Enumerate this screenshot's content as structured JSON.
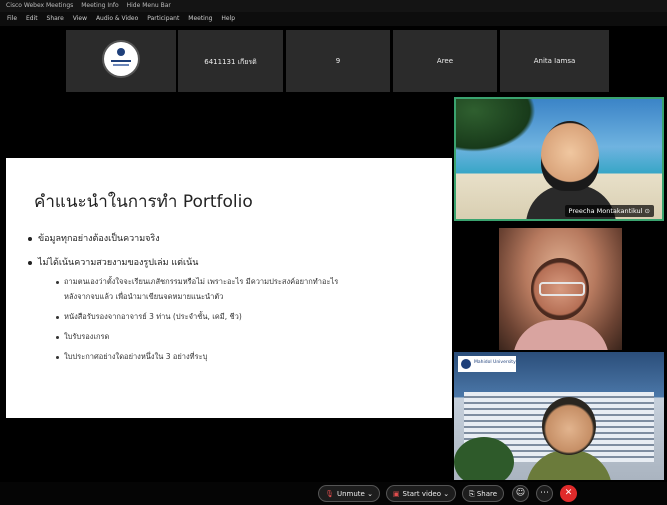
{
  "window": {
    "app_title": "Cisco Webex Meetings",
    "meeting_info": "Meeting Info",
    "hide_menu": "Hide Menu Bar"
  },
  "menu": [
    "File",
    "Edit",
    "Share",
    "View",
    "Audio & Video",
    "Participant",
    "Meeting",
    "Help"
  ],
  "participants_strip": [
    {
      "name": ""
    },
    {
      "name": "6411131 เกียรติ"
    },
    {
      "name": "9"
    },
    {
      "name": "Aree"
    },
    {
      "name": "Anita Iamsa"
    }
  ],
  "slide": {
    "title": "คำแนะนำในการทำ Portfolio",
    "bullets": [
      {
        "text": "ข้อมูลทุกอย่างต้องเป็นความจริง",
        "sub": []
      },
      {
        "text": "ไม่ได้เน้นความสวยงามของรูปเล่ม แต่เน้น",
        "sub": [
          "ถามตนเองว่าตั้งใจจะเรียนเภสัชกรรมหรือไม่ เพราะอะไร มีความประสงค์อยากทำอะไร",
          "หลังจากจบแล้ว เพื่อนำมาเขียนจดหมายแนะนำตัว",
          "หนังสือรับรองจากอาจารย์ 3 ท่าน (ประจำชั้น, เคมี, ชีว)",
          "ใบรับรองเกรด",
          "ใบประกาศอย่างใดอย่างหนึ่งใน 3 อย่างที่ระบุ"
        ]
      }
    ]
  },
  "video_tiles": [
    {
      "name": "Preecha Montakantikul"
    },
    {
      "name": ""
    },
    {
      "name": ""
    }
  ],
  "controls": {
    "unmute": "Unmute",
    "start_video": "Start video",
    "share": "Share"
  },
  "colors": {
    "end_button": "#e02b2b",
    "active_speaker_border": "#3aa36f"
  }
}
